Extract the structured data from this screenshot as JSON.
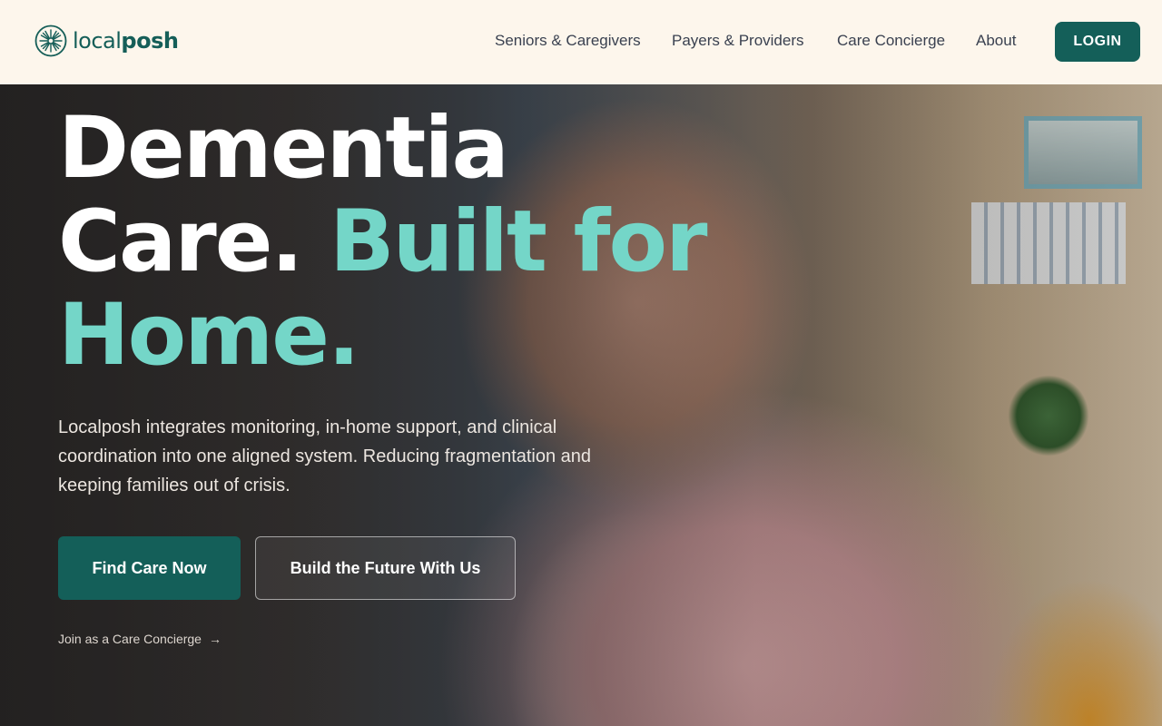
{
  "header": {
    "logo": {
      "text_regular": "local",
      "text_bold": "posh",
      "icon": "starburst-logo-icon"
    },
    "nav": [
      {
        "label": "Seniors & Caregivers"
      },
      {
        "label": "Payers & Providers"
      },
      {
        "label": "Care Concierge"
      },
      {
        "label": "About"
      }
    ],
    "login_label": "LOGIN"
  },
  "hero": {
    "headline_line1": "Dementia",
    "headline_line2_white": "Care.",
    "headline_line2_accent": "Built for",
    "headline_line3_accent": "Home.",
    "subtext": "Localposh integrates monitoring, in-home support, and clinical coordination into one aligned system. Reducing fragmentation and keeping families out of crisis.",
    "primary_cta": "Find Care Now",
    "secondary_cta": "Build the Future With Us",
    "tertiary_link": "Join as a Care Concierge",
    "tertiary_arrow": "→"
  },
  "colors": {
    "brand": "#145f59",
    "accent": "#74d6c8",
    "header_bg": "#fdf6ec"
  }
}
